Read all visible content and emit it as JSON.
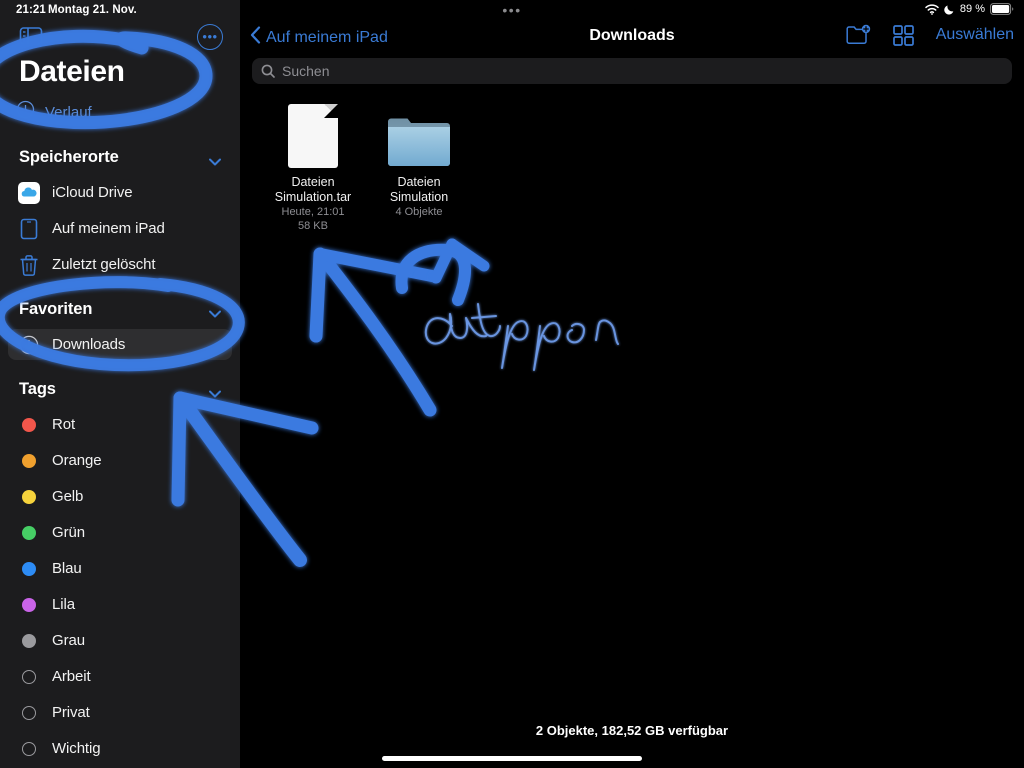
{
  "status_bar": {
    "time": "21:21",
    "date": "Montag 21. Nov.",
    "battery_percent": "89 %",
    "wifi_icon": "wifi-icon",
    "dnd_icon": "moon-icon",
    "battery_icon": "battery-icon",
    "camera_dots": "•••"
  },
  "sidebar": {
    "app_title": "Dateien",
    "toggle_icon": "sidebar-toggle-icon",
    "more_icon": "more-ellipsis-icon",
    "history": {
      "label": "Verlauf",
      "icon": "clock-icon"
    },
    "sections": [
      {
        "title": "Speicherorte",
        "chevron": "chevron-down-icon",
        "items": [
          {
            "label": "iCloud Drive",
            "icon": "icloud-icon",
            "selected": false
          },
          {
            "label": "Auf meinem iPad",
            "icon": "ipad-icon",
            "selected": false
          },
          {
            "label": "Zuletzt gelöscht",
            "icon": "trash-icon",
            "selected": false
          }
        ]
      },
      {
        "title": "Favoriten",
        "chevron": "chevron-down-icon",
        "items": [
          {
            "label": "Downloads",
            "icon": "download-circle-icon",
            "selected": true
          }
        ]
      },
      {
        "title": "Tags",
        "chevron": "chevron-down-icon",
        "items": [
          {
            "label": "Rot",
            "icon": "tag-dot-icon",
            "color": "#f2564b",
            "hollow": false
          },
          {
            "label": "Orange",
            "icon": "tag-dot-icon",
            "color": "#f0a02e",
            "hollow": false
          },
          {
            "label": "Gelb",
            "icon": "tag-dot-icon",
            "color": "#f6d33c",
            "hollow": false
          },
          {
            "label": "Grün",
            "icon": "tag-dot-icon",
            "color": "#46ce65",
            "hollow": false
          },
          {
            "label": "Blau",
            "icon": "tag-dot-icon",
            "color": "#2d8cf5",
            "hollow": false
          },
          {
            "label": "Lila",
            "icon": "tag-dot-icon",
            "color": "#c964e8",
            "hollow": false
          },
          {
            "label": "Grau",
            "icon": "tag-dot-icon",
            "color": "#9a9a9e",
            "hollow": false
          },
          {
            "label": "Arbeit",
            "icon": "tag-dot-icon",
            "color": "#9a9a9e",
            "hollow": true
          },
          {
            "label": "Privat",
            "icon": "tag-dot-icon",
            "color": "#9a9a9e",
            "hollow": true
          },
          {
            "label": "Wichtig",
            "icon": "tag-dot-icon",
            "color": "#9a9a9e",
            "hollow": true
          }
        ]
      }
    ]
  },
  "navbar": {
    "back_label": "Auf meinem iPad",
    "back_icon": "chevron-left-icon",
    "title": "Downloads",
    "new_folder_icon": "new-folder-icon",
    "grid_view_icon": "grid-view-icon",
    "select_label": "Auswählen"
  },
  "search": {
    "placeholder": "Suchen",
    "icon": "search-icon",
    "value": ""
  },
  "files": [
    {
      "name": "Dateien Simulation.tar",
      "type": "file",
      "icon": "document-icon",
      "meta_line1": "Heute, 21:01",
      "meta_line2": "58 KB"
    },
    {
      "name": "Dateien Simulation",
      "type": "folder",
      "icon": "folder-icon",
      "meta_line1": "4 Objekte",
      "meta_line2": ""
    }
  ],
  "footer": {
    "status": "2 Objekte, 182,52 GB verfügbar"
  },
  "annotations": {
    "ink_color": "#3b7ae0",
    "handwriting": "antippen",
    "marks": [
      {
        "name": "ellipse-around-dateien-title",
        "shape": "ellipse"
      },
      {
        "name": "ellipse-around-downloads-favoriten",
        "shape": "ellipse"
      },
      {
        "name": "arrow-to-downloads",
        "shape": "arrow"
      },
      {
        "name": "arrow-to-tar-file",
        "shape": "arrow"
      },
      {
        "name": "arrow-to-folder",
        "shape": "arrow"
      }
    ]
  }
}
